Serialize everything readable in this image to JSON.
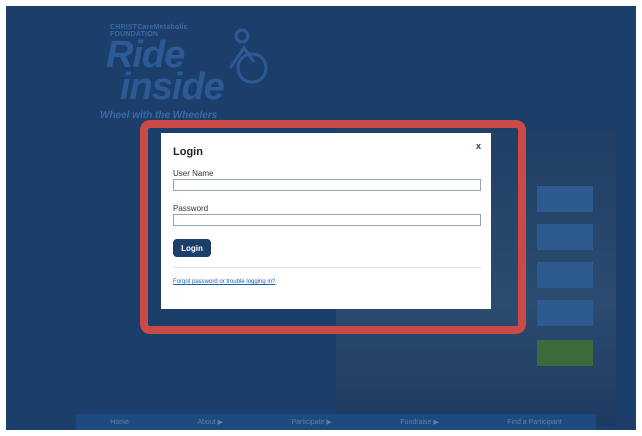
{
  "background": {
    "logo": {
      "org": "CHRISTCareMetabolic\nFOUNDATION",
      "ride": "Ride",
      "inside": "inside",
      "tagline": "Wheel with the Wheelers"
    },
    "nav": [
      "Home",
      "About ▶",
      "Participate ▶",
      "Fundraise ▶",
      "Find a Participant"
    ]
  },
  "modal": {
    "title": "Login",
    "close": "x",
    "username_label": "User Name",
    "password_label": "Password",
    "login_button": "Login",
    "forgot_link": "Forgot password or trouble logging in?"
  },
  "colors": {
    "page_bg": "#1b3e6a",
    "highlight": "#cc4a46",
    "button": "#1b3e6a",
    "link": "#1b5fa8"
  }
}
